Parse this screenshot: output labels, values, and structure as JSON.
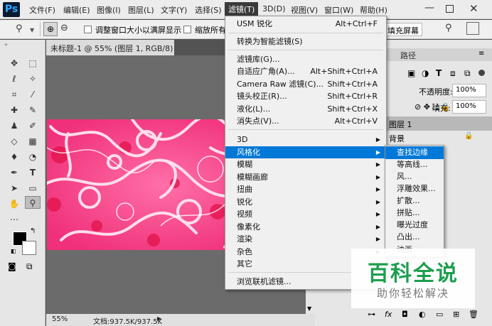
{
  "app": {
    "logo": "Ps"
  },
  "menubar": {
    "items": [
      "文件(F)",
      "编辑(E)",
      "图像(I)",
      "图层(L)",
      "文字(Y)",
      "选择(S)",
      "滤镜(T)",
      "3D(D)",
      "视图(V)",
      "窗口(W)",
      "帮助(H)"
    ],
    "active": "滤镜(T)"
  },
  "options": {
    "resize_label": "调整窗口大小以满屏显示",
    "zoom_all_label": "缩放所有",
    "fill_screen": "填充屏幕"
  },
  "document": {
    "tab_title": "未标题-1 @ 55% (图层 1, RGB/8) *",
    "zoom": "55%",
    "doc_info": "文档:937.5K/937.5K"
  },
  "filter_menu": {
    "items": [
      {
        "label": "USM 锐化",
        "shortcut": "Alt+Ctrl+F"
      },
      {
        "label": "转换为智能滤镜(S)",
        "shortcut": ""
      },
      {
        "label": "滤镜库(G)...",
        "shortcut": ""
      },
      {
        "label": "自适应广角(A)...",
        "shortcut": "Alt+Shift+Ctrl+A"
      },
      {
        "label": "Camera Raw 滤镜(C)...",
        "shortcut": "Shift+Ctrl+A"
      },
      {
        "label": "镜头校正(R)...",
        "shortcut": "Shift+Ctrl+R"
      },
      {
        "label": "液化(L)...",
        "shortcut": "Shift+Ctrl+X"
      },
      {
        "label": "消失点(V)...",
        "shortcut": "Alt+Ctrl+V"
      },
      {
        "label": "3D",
        "shortcut": ""
      },
      {
        "label": "风格化",
        "shortcut": ""
      },
      {
        "label": "模糊",
        "shortcut": ""
      },
      {
        "label": "模糊画廊",
        "shortcut": ""
      },
      {
        "label": "扭曲",
        "shortcut": ""
      },
      {
        "label": "锐化",
        "shortcut": ""
      },
      {
        "label": "视频",
        "shortcut": ""
      },
      {
        "label": "像素化",
        "shortcut": ""
      },
      {
        "label": "渲染",
        "shortcut": ""
      },
      {
        "label": "杂色",
        "shortcut": ""
      },
      {
        "label": "其它",
        "shortcut": ""
      },
      {
        "label": "浏览联机滤镜...",
        "shortcut": ""
      }
    ],
    "highlighted": "风格化"
  },
  "stylize_submenu": {
    "items": [
      "查找边缘",
      "等高线...",
      "风...",
      "浮雕效果...",
      "扩散...",
      "拼贴...",
      "曝光过度",
      "凸出...",
      "油画..."
    ],
    "highlighted": "查找边缘"
  },
  "layers_panel": {
    "tab_paths": "路径",
    "opacity_label": "不透明度:",
    "opacity_value": "100%",
    "fill_label": "填充:",
    "fill_value": "100%",
    "layer1": "图层 1",
    "background": "背景"
  },
  "watermark": {
    "title": "百科全说",
    "subtitle": "助你轻松解决"
  },
  "colors": {
    "menu_highlight": "#0078d7",
    "menubar_active": "#3a3a3a",
    "watermark_green": "#1e9e4f"
  }
}
